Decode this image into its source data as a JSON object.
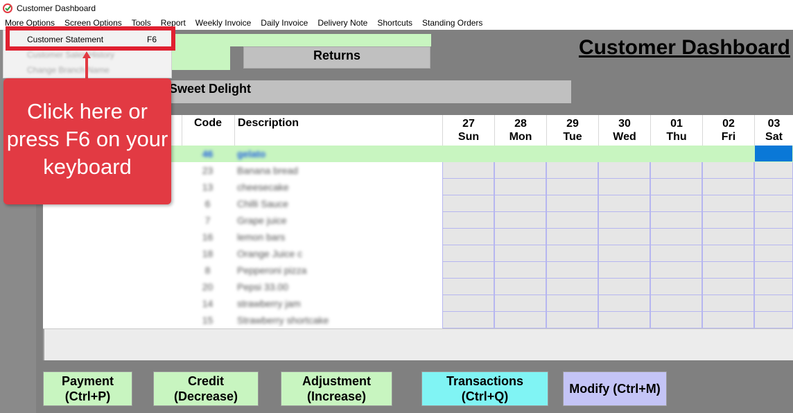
{
  "window": {
    "title": "Customer Dashboard"
  },
  "menubar": {
    "items": [
      "More Options",
      "Screen Options",
      "Tools",
      "Report",
      "Weekly Invoice",
      "Daily Invoice",
      "Delivery Note",
      "Shortcuts",
      "Standing Orders"
    ]
  },
  "dropdown": {
    "statement_label": "Customer Statement",
    "statement_shortcut": "F6",
    "faded_item_1": "Customer Sales History",
    "faded_item_2": "Change Branch Name"
  },
  "callout": {
    "text": "Click here or press F6 on your keyboard"
  },
  "page": {
    "title": "Customer Dashboard",
    "returns_label": "Returns",
    "customer_name": "Sweet Delight"
  },
  "grid": {
    "headers": {
      "code": "Code",
      "description": "Description"
    },
    "days": [
      {
        "num": "27",
        "name": "Sun"
      },
      {
        "num": "28",
        "name": "Mon"
      },
      {
        "num": "29",
        "name": "Tue"
      },
      {
        "num": "30",
        "name": "Wed"
      },
      {
        "num": "01",
        "name": "Thu"
      },
      {
        "num": "02",
        "name": "Fri"
      },
      {
        "num": "03",
        "name": "Sat"
      }
    ],
    "rows": [
      {
        "name": "",
        "code": "46",
        "description": "gelato"
      },
      {
        "name": "",
        "code": "23",
        "description": "Banana bread"
      },
      {
        "name": "",
        "code": "13",
        "description": "cheesecake"
      },
      {
        "name": "",
        "code": "6",
        "description": "Chilli Sauce"
      },
      {
        "name": "",
        "code": "7",
        "description": "Grape juice"
      },
      {
        "name": "",
        "code": "16",
        "description": "lemon bars"
      },
      {
        "name": "",
        "code": "18",
        "description": "Orange Juice c"
      },
      {
        "name": "",
        "code": "8",
        "description": "Pepperoni pizza"
      },
      {
        "name": "",
        "code": "20",
        "description": "Pepsi 33.00"
      },
      {
        "name": "",
        "code": "14",
        "description": "strawberry jam"
      },
      {
        "name": "",
        "code": "15",
        "description": "Strawberry shortcake"
      }
    ]
  },
  "buttons": {
    "payment": [
      "Payment",
      "(Ctrl+P)"
    ],
    "credit": [
      "Credit",
      "(Decrease)"
    ],
    "adjustment": [
      "Adjustment",
      "(Increase)"
    ],
    "transactions": [
      "Transactions",
      "(Ctrl+Q)"
    ],
    "modify": "Modify (Ctrl+M)"
  },
  "colors": {
    "green_bg": "#c8f5c0",
    "cyan_bg": "#80f4f4",
    "lavender_bg": "#c4c4f6",
    "callout_red": "#e23a43",
    "selection_blue": "#0a78d7"
  }
}
